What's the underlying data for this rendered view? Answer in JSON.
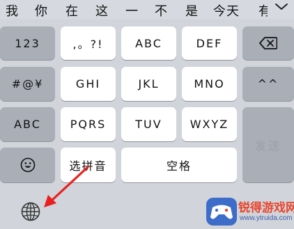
{
  "candidates": [
    "我",
    "你",
    "在",
    "这",
    "一",
    "不",
    "是",
    "今天",
    "有"
  ],
  "keys": {
    "numbers": "123",
    "punct": ",。?!",
    "abc1": "ABC",
    "def": "DEF",
    "symbols": "#@¥",
    "ghi": "GHI",
    "jkl": "JKL",
    "mno": "MNO",
    "emoticon": "^^",
    "abc_mode": "ABC",
    "pqrs": "PQRS",
    "tuv": "TUV",
    "wxyz": "WXYZ",
    "send": "发送",
    "pinyin": "选拼音",
    "space": "空格"
  },
  "watermark": {
    "title": "锐得游戏网",
    "url": "www.ytruida.com"
  }
}
